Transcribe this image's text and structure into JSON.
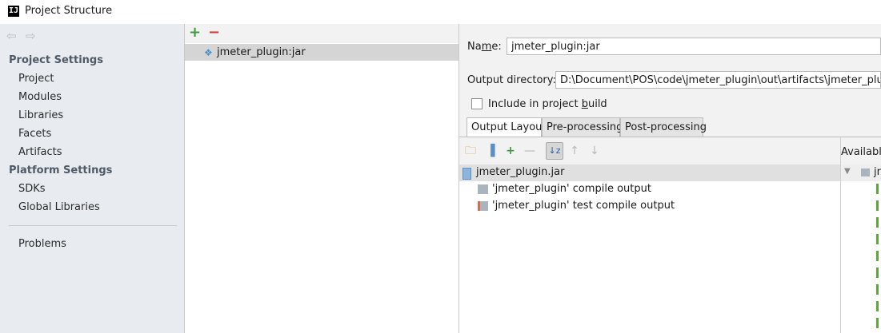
{
  "window": {
    "title": "Project Structure",
    "app_icon": "intellij-icon"
  },
  "sidebar": {
    "project_settings_title": "Project Settings",
    "project_items": [
      "Project",
      "Modules",
      "Libraries",
      "Facets",
      "Artifacts"
    ],
    "platform_settings_title": "Platform Settings",
    "platform_items": [
      "SDKs",
      "Global Libraries"
    ],
    "problems": "Problems"
  },
  "artifacts_list": {
    "add_icon": "+",
    "remove_icon": "−",
    "items": [
      "jmeter_plugin:jar"
    ]
  },
  "detail": {
    "name_label_pre": "Na",
    "name_label_mnemonic": "m",
    "name_label_post": "e:",
    "name_value": "jmeter_plugin:jar",
    "output_dir_label": "Output directory:",
    "output_dir_value": "D:\\Document\\POS\\code\\jmeter_plugin\\out\\artifacts\\jmeter_plugin_jar",
    "include_label_pre": "Include in project ",
    "include_label_mnemonic": "b",
    "include_label_post": "uild",
    "include_checked": false,
    "tabs": [
      "Output Layout",
      "Pre-processing",
      "Post-processing"
    ],
    "active_tab": "Output Layout",
    "layout_root": "jmeter_plugin.jar",
    "layout_children": [
      "'jmeter_plugin' compile output",
      "'jmeter_plugin' test compile output"
    ],
    "available_label": "Available",
    "available_root_partial": "jn"
  },
  "colors": {
    "green": "#3c9a3c",
    "red": "#d93b3b",
    "selection": "#d5d5d5",
    "sidebar_bg": "#e8ecf1"
  }
}
